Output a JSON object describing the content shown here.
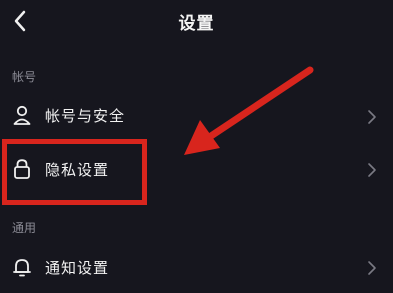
{
  "header": {
    "title": "设置",
    "back_icon": "chevron-left-icon"
  },
  "sections": [
    {
      "label": "帐号",
      "items": [
        {
          "label": "帐号与安全",
          "icon": "user-icon"
        },
        {
          "label": "隐私设置",
          "icon": "lock-icon"
        }
      ]
    },
    {
      "label": "通用",
      "items": [
        {
          "label": "通知设置",
          "icon": "bell-icon"
        }
      ]
    }
  ],
  "colors": {
    "background": "#16161e",
    "text": "#f2f2f2",
    "muted": "#8b8b95",
    "annotation": "#d8251d"
  }
}
